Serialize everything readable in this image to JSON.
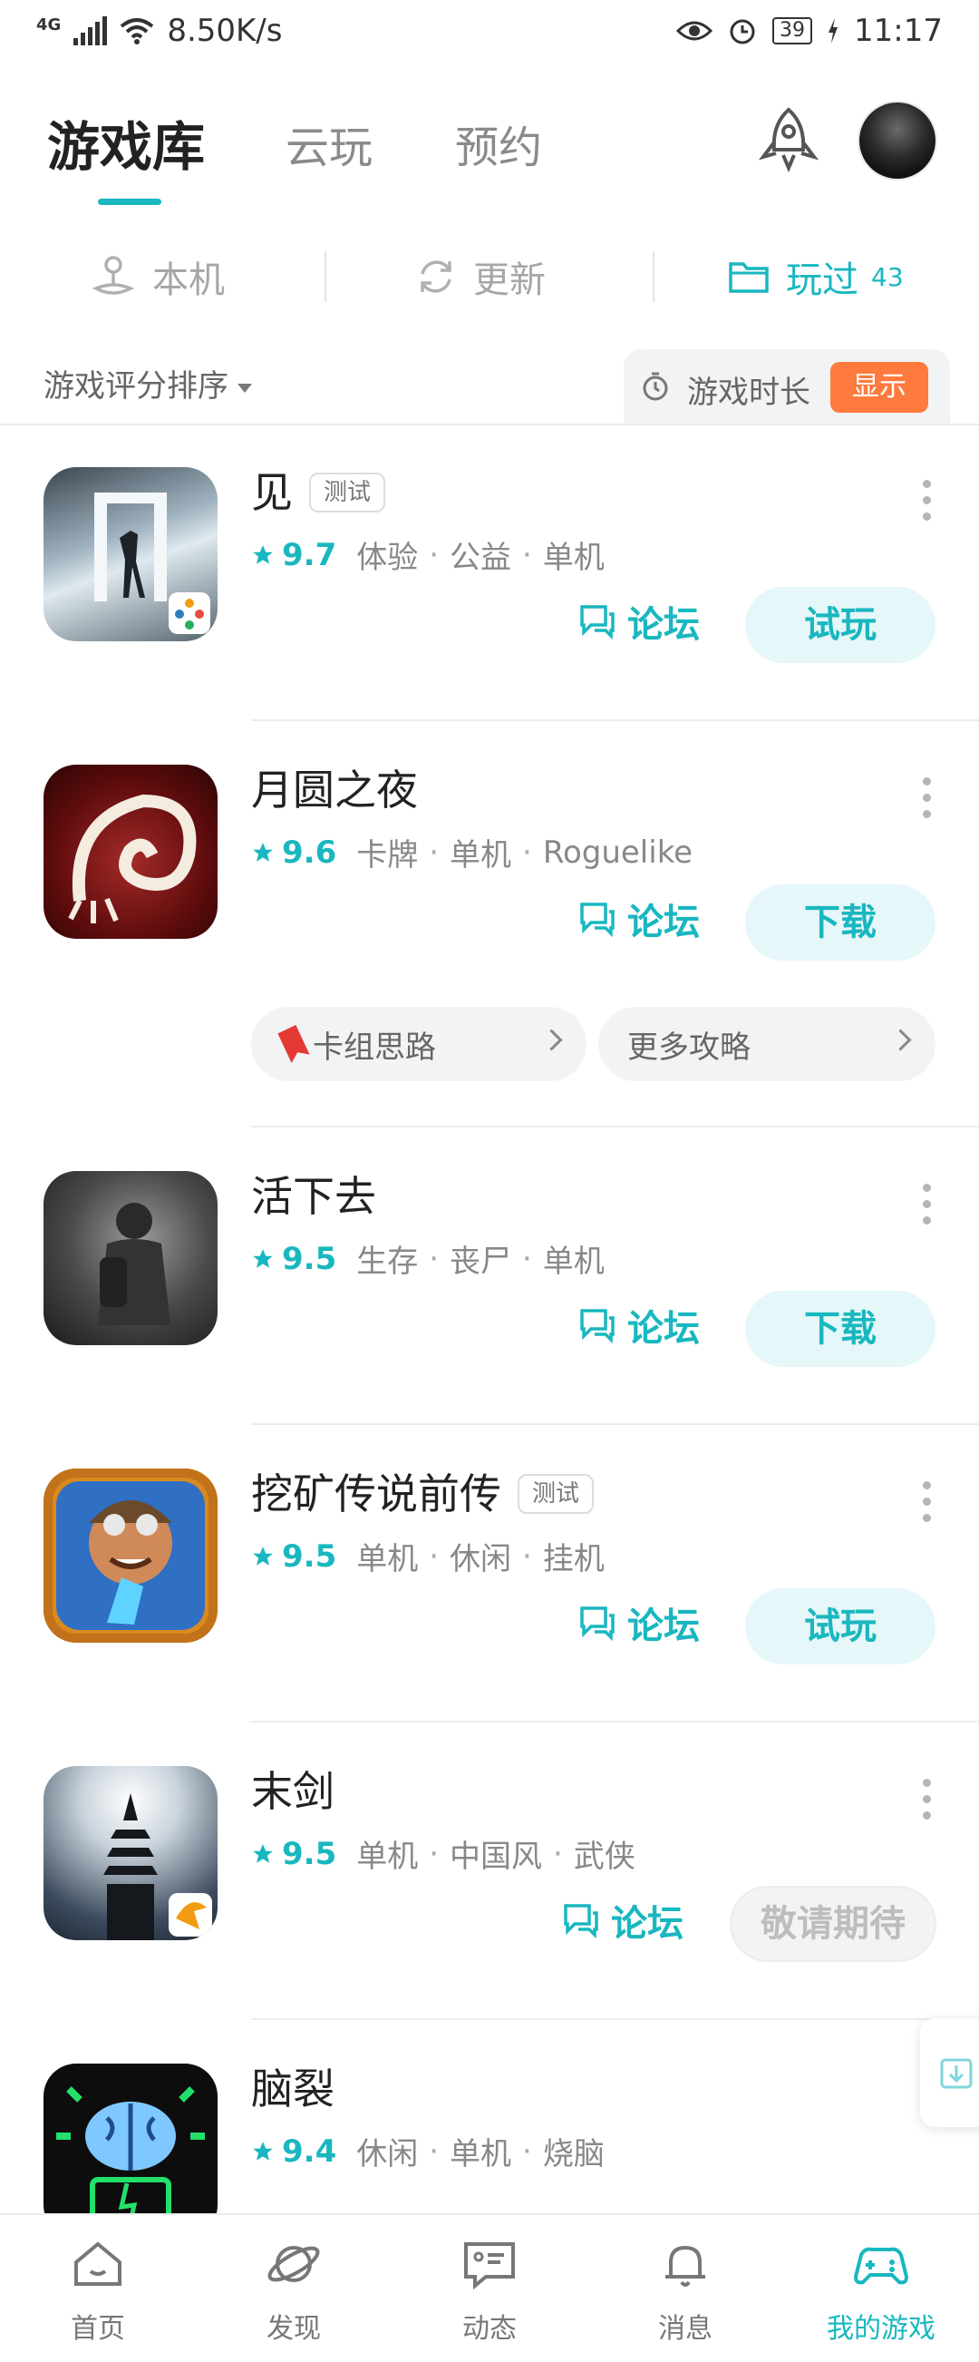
{
  "status_bar": {
    "network": "4G",
    "speed": "8.50K/s",
    "battery": "39",
    "time": "11:17"
  },
  "header": {
    "tabs": [
      {
        "label": "游戏库",
        "active": true
      },
      {
        "label": "云玩",
        "active": false
      },
      {
        "label": "预约",
        "active": false
      }
    ],
    "rocket_icon": "rocket-icon",
    "avatar_icon": "avatar"
  },
  "subtabs": [
    {
      "label": "本机",
      "icon": "joystick-icon",
      "active": false
    },
    {
      "label": "更新",
      "icon": "refresh-icon",
      "active": false
    },
    {
      "label": "玩过",
      "icon": "folder-icon",
      "count": "43",
      "active": true
    }
  ],
  "sort": {
    "label": "游戏评分排序",
    "duration_label": "游戏时长",
    "show_button": "显示"
  },
  "games": [
    {
      "name": "见",
      "tag": "测试",
      "score": "9.7",
      "tags": [
        "体验",
        "公益",
        "单机"
      ],
      "forum": "论坛",
      "action": "试玩",
      "action_disabled": false
    },
    {
      "name": "月圆之夜",
      "tag": "",
      "score": "9.6",
      "tags": [
        "卡牌",
        "单机",
        "Roguelike"
      ],
      "forum": "论坛",
      "action": "下载",
      "action_disabled": false,
      "guides": [
        {
          "label": "卡组思路"
        },
        {
          "label": "更多攻略"
        }
      ]
    },
    {
      "name": "活下去",
      "tag": "",
      "score": "9.5",
      "tags": [
        "生存",
        "丧尸",
        "单机"
      ],
      "forum": "论坛",
      "action": "下载",
      "action_disabled": false
    },
    {
      "name": "挖矿传说前传",
      "tag": "测试",
      "score": "9.5",
      "tags": [
        "单机",
        "休闲",
        "挂机"
      ],
      "forum": "论坛",
      "action": "试玩",
      "action_disabled": false
    },
    {
      "name": "末剑",
      "tag": "",
      "score": "9.5",
      "tags": [
        "单机",
        "中国风",
        "武侠"
      ],
      "forum": "论坛",
      "action": "敬请期待",
      "action_disabled": true
    },
    {
      "name": "脑裂",
      "tag": "",
      "score": "9.4",
      "tags": [
        "休闲",
        "单机",
        "烧脑"
      ],
      "forum": "",
      "action": "",
      "action_disabled": false
    }
  ],
  "bottom_nav": [
    {
      "label": "首页",
      "icon": "home-icon",
      "active": false
    },
    {
      "label": "发现",
      "icon": "planet-icon",
      "active": false
    },
    {
      "label": "动态",
      "icon": "chat-card-icon",
      "active": false
    },
    {
      "label": "消息",
      "icon": "bell-icon",
      "active": false
    },
    {
      "label": "我的游戏",
      "icon": "gamepad-icon",
      "active": true
    }
  ],
  "colors": {
    "accent": "#19b7bf",
    "orange": "#ff7a3d",
    "text": "#222222",
    "muted": "#888888"
  }
}
